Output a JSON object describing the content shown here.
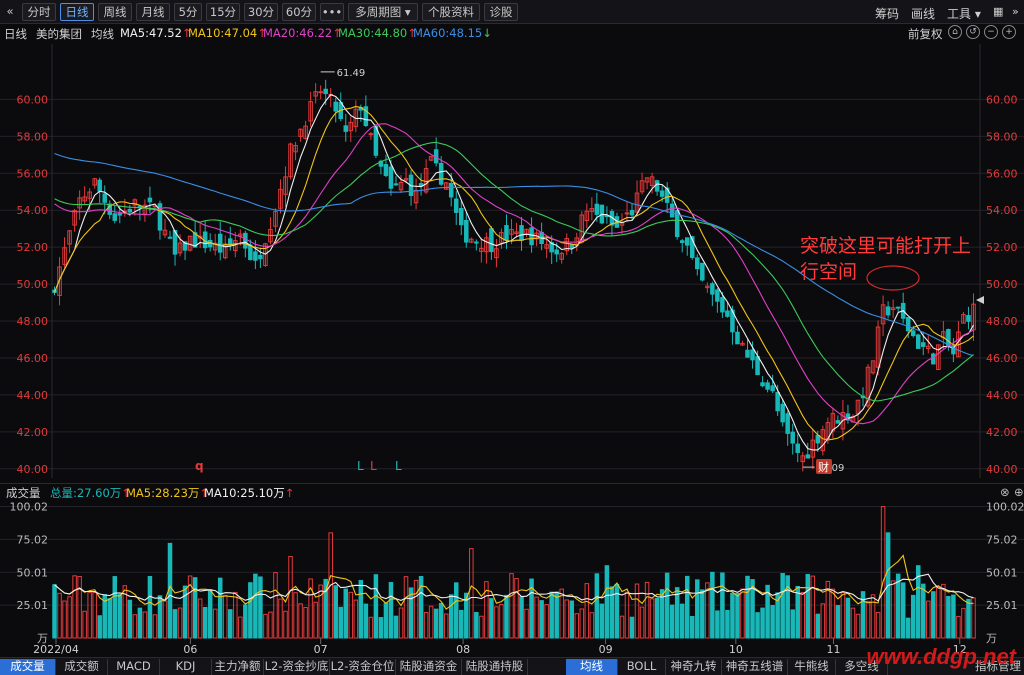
{
  "toolbar": {
    "back_icon": "double-chevron-left",
    "tabs": [
      "分时",
      "日线",
      "周线",
      "月线",
      "5分",
      "15分",
      "30分",
      "60分",
      "•••",
      "多周期图 ▾",
      "个股资料",
      "诊股"
    ],
    "active_tab": "日线",
    "right_items": [
      "筹码",
      "画线",
      "工具 ▾"
    ],
    "right_icons": [
      "grid-icon",
      "collapse-icon"
    ]
  },
  "legend": {
    "period": "日线",
    "stock_name": "美的集团",
    "ma_label": "均线",
    "ma5": "MA5:47.52",
    "ma10": "MA10:47.04",
    "ma20": "MA20:46.22",
    "ma30": "MA30:44.80",
    "ma60": "MA60:48.15",
    "adjust": "前复权",
    "colors": {
      "ma5": "#f0f0f0",
      "ma10": "#f0c419",
      "ma20": "#e040c8",
      "ma30": "#3cc85a",
      "ma60": "#3a8ee6",
      "up": "#e23a3a",
      "down": "#19b8b8"
    }
  },
  "volume_header": {
    "title": "成交量",
    "total": "总量:27.60万",
    "ma5": "MA5:28.23万",
    "ma10": "MA10:25.10万"
  },
  "annotation": {
    "line1": "突破这里可能打开上",
    "line2": "行空间"
  },
  "markers": {
    "q": "q",
    "l1": "L",
    "l2": "L",
    "l3": "L",
    "cai": "财",
    "high": "61.49",
    "low": "40.09"
  },
  "bottom_tabs_left": [
    "成交量",
    "成交额",
    "MACD",
    "KDJ",
    "主力净额",
    "L2-资金抄底",
    "L2-资金仓位",
    "陆股通资金",
    "陆股通持股"
  ],
  "bottom_tabs_right": [
    "均线",
    "BOLL",
    "神奇九转",
    "神奇五线谱",
    "牛熊线",
    "多空线"
  ],
  "bottom_right": "指标管理",
  "watermark": "www.ddgp.net",
  "chart_data": {
    "type": "candlestick",
    "x_months": [
      "2022/04",
      "06",
      "07",
      "08",
      "09",
      "10",
      "11",
      "12"
    ],
    "price_ticks": [
      "60.00",
      "58.00",
      "56.00",
      "54.00",
      "52.00",
      "50.00",
      "48.00",
      "46.00",
      "44.00",
      "42.00",
      "40.00"
    ],
    "price_ylim": [
      39.5,
      63
    ],
    "volume_ticks": [
      "100.02",
      "75.02",
      "50.01",
      "25.01",
      "万"
    ],
    "volume_ylim": [
      0,
      105
    ],
    "close_anchors": [
      [
        0,
        50.0
      ],
      [
        2,
        51.8
      ],
      [
        5,
        54.5
      ],
      [
        8,
        55.5
      ],
      [
        12,
        53.6
      ],
      [
        16,
        54.3
      ],
      [
        20,
        54.0
      ],
      [
        24,
        51.5
      ],
      [
        27,
        52.4
      ],
      [
        30,
        52.2
      ],
      [
        34,
        51.8
      ],
      [
        37,
        52.7
      ],
      [
        40,
        51.0
      ],
      [
        44,
        54.2
      ],
      [
        47,
        57.2
      ],
      [
        50,
        59.0
      ],
      [
        53,
        60.5
      ],
      [
        56,
        59.5
      ],
      [
        58,
        58.0
      ],
      [
        61,
        59.7
      ],
      [
        64,
        56.8
      ],
      [
        67,
        55.0
      ],
      [
        70,
        55.6
      ],
      [
        72,
        54.8
      ],
      [
        75,
        56.5
      ],
      [
        78,
        55.5
      ],
      [
        81,
        52.8
      ],
      [
        84,
        52.4
      ],
      [
        87,
        52.2
      ],
      [
        90,
        52.6
      ],
      [
        94,
        52.7
      ],
      [
        97,
        52.3
      ],
      [
        100,
        51.8
      ],
      [
        103,
        52.3
      ],
      [
        106,
        54.0
      ],
      [
        109,
        53.5
      ],
      [
        112,
        53.0
      ],
      [
        115,
        54.0
      ],
      [
        118,
        55.8
      ],
      [
        120,
        55.2
      ],
      [
        123,
        53.5
      ],
      [
        126,
        52.0
      ],
      [
        128,
        50.4
      ],
      [
        131,
        49.3
      ],
      [
        134,
        48.3
      ],
      [
        137,
        46.5
      ],
      [
        140,
        45.3
      ],
      [
        143,
        44.0
      ],
      [
        145,
        42.2
      ],
      [
        147,
        41.2
      ],
      [
        149,
        40.6
      ],
      [
        151,
        41.4
      ],
      [
        154,
        42.6
      ],
      [
        157,
        42.9
      ],
      [
        159,
        43.0
      ],
      [
        161,
        44.2
      ],
      [
        163,
        46.0
      ],
      [
        165,
        48.5
      ],
      [
        167,
        48.8
      ],
      [
        169,
        48.0
      ],
      [
        172,
        46.8
      ],
      [
        175,
        46.1
      ],
      [
        177,
        47.0
      ],
      [
        179,
        46.2
      ],
      [
        181,
        48.2
      ],
      [
        183,
        48.6
      ]
    ],
    "high": 61.49,
    "low": 40.09,
    "last_ma": {
      "MA5": 47.52,
      "MA10": 47.04,
      "MA20": 46.22,
      "MA30": 44.8,
      "MA60": 48.15
    }
  }
}
